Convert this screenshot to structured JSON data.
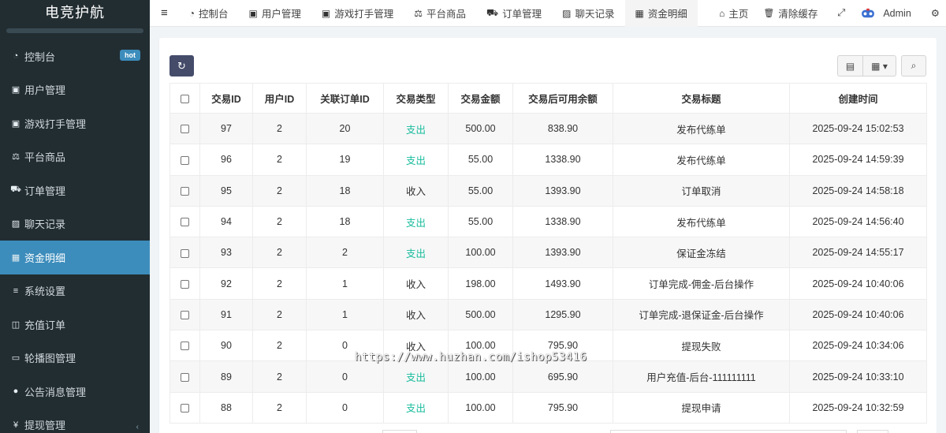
{
  "app": {
    "logo": "电竞护航"
  },
  "sidebar": {
    "items": [
      {
        "label": "控制台",
        "icon": "dashboard-icon",
        "glyph": "◔",
        "badge": "hot"
      },
      {
        "label": "用户管理",
        "icon": "user-icon",
        "glyph": "▣"
      },
      {
        "label": "游戏打手管理",
        "icon": "user-icon",
        "glyph": "▣"
      },
      {
        "label": "平台商品",
        "icon": "balance-scale-icon",
        "glyph": "⚖"
      },
      {
        "label": "订单管理",
        "icon": "cart-icon",
        "glyph": "⛟"
      },
      {
        "label": "聊天记录",
        "icon": "image-icon",
        "glyph": "▨"
      },
      {
        "label": "资金明细",
        "icon": "calendar-icon",
        "glyph": "▦",
        "active": true
      },
      {
        "label": "系统设置",
        "icon": "list-icon",
        "glyph": "≡"
      },
      {
        "label": "充值订单",
        "icon": "book-icon",
        "glyph": "◫"
      },
      {
        "label": "轮播图管理",
        "icon": "cc-icon",
        "glyph": "▭"
      },
      {
        "label": "公告消息管理",
        "icon": "comment-icon",
        "glyph": "●"
      },
      {
        "label": "提现管理",
        "icon": "yen-icon",
        "glyph": "¥",
        "chevron": "‹"
      }
    ]
  },
  "topnav": {
    "menu_glyph": "≡",
    "tabs": [
      {
        "label": "控制台",
        "icon": "dashboard-icon",
        "glyph": "◔"
      },
      {
        "label": "用户管理",
        "icon": "user-icon",
        "glyph": "▣"
      },
      {
        "label": "游戏打手管理",
        "icon": "user-icon",
        "glyph": "▣"
      },
      {
        "label": "平台商品",
        "icon": "balance-scale-icon",
        "glyph": "⚖"
      },
      {
        "label": "订单管理",
        "icon": "cart-icon",
        "glyph": "⛟"
      },
      {
        "label": "聊天记录",
        "icon": "image-icon",
        "glyph": "▨"
      },
      {
        "label": "资金明细",
        "icon": "calendar-icon",
        "glyph": "▦",
        "active": true
      }
    ],
    "home": {
      "label": "主页",
      "glyph": "⌂"
    },
    "clear_cache": {
      "label": "清除缓存",
      "glyph": "🗑"
    },
    "fullscreen_glyph": "⤢",
    "user": {
      "name": "Admin"
    },
    "settings_glyph": "⚙"
  },
  "toolbar": {
    "refresh_glyph": "↻",
    "table_view_glyph": "▤",
    "columns_glyph": "▦ ▾",
    "search_glyph": "⌕"
  },
  "table": {
    "columns": [
      "交易ID",
      "用户ID",
      "关联订单ID",
      "交易类型",
      "交易金额",
      "交易后可用余额",
      "交易标题",
      "创建时间"
    ],
    "rows": [
      {
        "id": "97",
        "uid": "2",
        "order_id": "20",
        "type": "支出",
        "amount": "500.00",
        "balance": "838.90",
        "title": "发布代练单",
        "time": "2025-09-24 15:02:53"
      },
      {
        "id": "96",
        "uid": "2",
        "order_id": "19",
        "type": "支出",
        "amount": "55.00",
        "balance": "1338.90",
        "title": "发布代练单",
        "time": "2025-09-24 14:59:39"
      },
      {
        "id": "95",
        "uid": "2",
        "order_id": "18",
        "type": "收入",
        "amount": "55.00",
        "balance": "1393.90",
        "title": "订单取消",
        "time": "2025-09-24 14:58:18"
      },
      {
        "id": "94",
        "uid": "2",
        "order_id": "18",
        "type": "支出",
        "amount": "55.00",
        "balance": "1338.90",
        "title": "发布代练单",
        "time": "2025-09-24 14:56:40"
      },
      {
        "id": "93",
        "uid": "2",
        "order_id": "2",
        "type": "支出",
        "amount": "100.00",
        "balance": "1393.90",
        "title": "保证金冻结",
        "time": "2025-09-24 14:55:17"
      },
      {
        "id": "92",
        "uid": "2",
        "order_id": "1",
        "type": "收入",
        "amount": "198.00",
        "balance": "1493.90",
        "title": "订单完成-佣金-后台操作",
        "time": "2025-09-24 10:40:06"
      },
      {
        "id": "91",
        "uid": "2",
        "order_id": "1",
        "type": "收入",
        "amount": "500.00",
        "balance": "1295.90",
        "title": "订单完成-退保证金-后台操作",
        "time": "2025-09-24 10:40:06"
      },
      {
        "id": "90",
        "uid": "2",
        "order_id": "0",
        "type": "收入",
        "amount": "100.00",
        "balance": "795.90",
        "title": "提现失败",
        "time": "2025-09-24 10:34:06"
      },
      {
        "id": "89",
        "uid": "2",
        "order_id": "0",
        "type": "支出",
        "amount": "100.00",
        "balance": "695.90",
        "title": "用户充值-后台-111111111",
        "time": "2025-09-24 10:33:10"
      },
      {
        "id": "88",
        "uid": "2",
        "order_id": "0",
        "type": "支出",
        "amount": "100.00",
        "balance": "795.90",
        "title": "提现申请",
        "time": "2025-09-24 10:32:59"
      }
    ]
  },
  "watermark": "https://www.huzhan.com/ishop53416",
  "colors": {
    "sidebar_bg": "#222d32",
    "active": "#3c8dbc",
    "expense": "#18bc9c",
    "refresh_btn": "#444c6a"
  }
}
